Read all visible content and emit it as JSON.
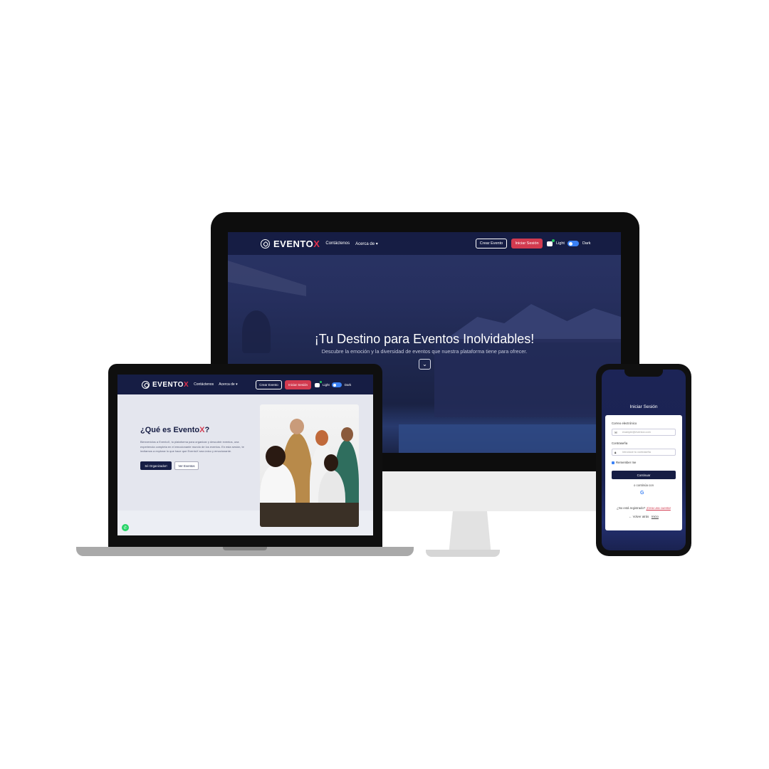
{
  "brand": {
    "logo_main": "EVENTO",
    "logo_x": "X"
  },
  "nav": {
    "contact": "Contáctenos",
    "about": "Acerca de ▾",
    "create_event": "Crear Evento",
    "login": "Iniciar Sesión",
    "light": "Light",
    "dark": "Dark"
  },
  "hero": {
    "title": "¡Tu Destino para Eventos Inolvidables!",
    "subtitle": "Descubre la emoción y la diversidad de eventos que nuestra plataforma tiene para ofrecer.",
    "scroll_icon": "chevron-down-icon"
  },
  "about": {
    "heading_main": "¿Qué es Evento",
    "heading_x": "X",
    "heading_end": "?",
    "paragraph": "Bienvenidos a EventoX, tu plataforma para organizar y descubrir eventos, una experiencia completa en el emocionante mundo de los eventos. En esta sesión, te invitamos a explorar lo que hace que EventoX sea único y emocionante.",
    "btn_organizer": "Sé Organizador!",
    "btn_events": "Ver Eventos"
  },
  "login_form": {
    "title": "Iniciar Sesión",
    "email_label": "Correo electrónico",
    "email_placeholder": "example@eventox.com",
    "password_label": "Contraseña",
    "password_placeholder": "Introduce tu contraseña",
    "remember": "Remember me",
    "continue": "Continuar",
    "or_continue": "o continúa con",
    "no_account": "¿No está registrado?",
    "create_account": "¡Crea una cuenta!",
    "back": "← Volver atrás",
    "home": "Inicio"
  },
  "colors": {
    "navy": "#161d44",
    "accent_red": "#d23a4f",
    "toggle_blue": "#3b82f6",
    "whatsapp": "#25d366"
  }
}
